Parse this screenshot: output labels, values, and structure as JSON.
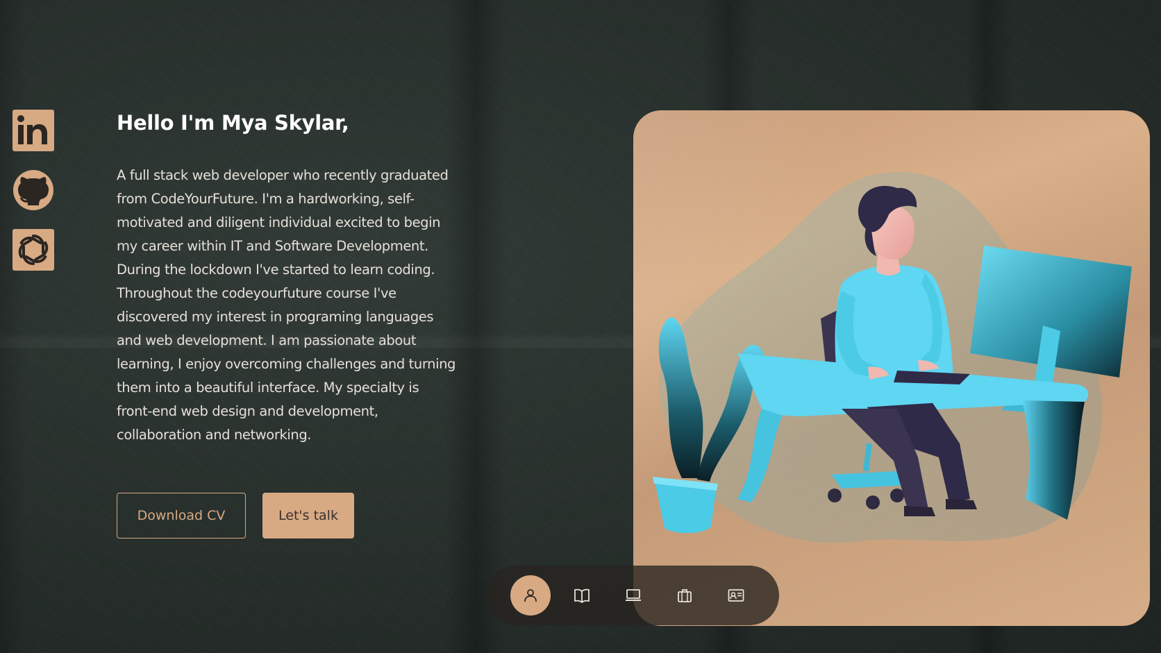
{
  "social": {
    "items": [
      {
        "icon": "linkedin-icon",
        "label": "in"
      },
      {
        "icon": "github-icon"
      },
      {
        "icon": "openai-icon"
      }
    ]
  },
  "hero": {
    "greeting": "Hello I'm Mya Skylar,",
    "bio_lines": [
      "A full stack web developer who recently graduated",
      "from CodeYourFuture. I'm a hardworking, self-",
      "motivated and diligent individual excited to begin",
      "my career within IT and Software Development.",
      "During the lockdown I've started to learn coding.",
      "Throughout the codeyourfuture course I've",
      "discovered my interest in programing languages",
      "and web development. I am passionate about",
      "learning, I enjoy overcoming challenges and turning",
      "them into a beautiful interface. My specialty is",
      "front-end web design and development,",
      "collaboration and networking."
    ],
    "download_cv_label": "Download CV",
    "lets_talk_label": "Let's talk"
  },
  "illustration": {
    "icon": "developer-at-desk-illustration"
  },
  "nav": {
    "items": [
      {
        "icon": "user-icon",
        "active": true
      },
      {
        "icon": "book-icon",
        "active": false
      },
      {
        "icon": "laptop-icon",
        "active": false
      },
      {
        "icon": "briefcase-icon",
        "active": false
      },
      {
        "icon": "contact-card-icon",
        "active": false
      }
    ]
  },
  "colors": {
    "accent": "#d7aa84",
    "background": "#2a312e",
    "text": "#e6e0d9",
    "illustration_blue": "#5fd6f2"
  }
}
